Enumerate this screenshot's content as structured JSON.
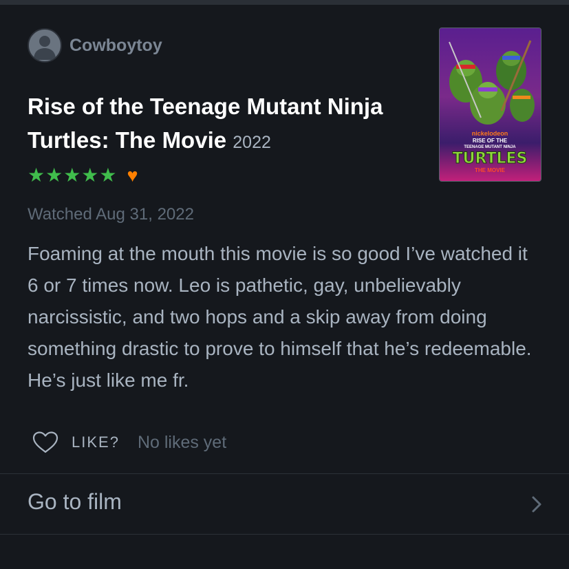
{
  "reviewer": {
    "username": "Cowboytoy"
  },
  "film": {
    "title": "Rise of the Teenage Mutant Ninja Turtles: The Movie",
    "year": "2022",
    "rating_stars": "★★★★★",
    "rating_value": 5,
    "liked_icon": "heart-filled-icon",
    "poster": {
      "network": "nickelodeon",
      "line1": "RISE OF THE",
      "line2": "TEENAGE MUTANT NINJA",
      "logo": "TURTLES",
      "subtitle": "THE MOVIE"
    }
  },
  "review": {
    "watched": "Watched Aug 31, 2022",
    "body": "Foaming at the mouth this movie is so good I’ve watched it 6 or 7 times now. Leo is pathetic, gay, unbelievably narcissistic, and two hops and a skip away from doing something drastic to prove to himself that he’s redeemable. He’s just like me fr."
  },
  "like": {
    "label": "LIKE?",
    "count_text": "No likes yet"
  },
  "navigation": {
    "go_to_film": "Go to film"
  },
  "colors": {
    "background": "#15181d",
    "stars": "#40bd4c",
    "liked_heart": "#ff8000",
    "title": "#ffffff",
    "text": "#a9b4c1",
    "muted": "#5f6b78"
  }
}
